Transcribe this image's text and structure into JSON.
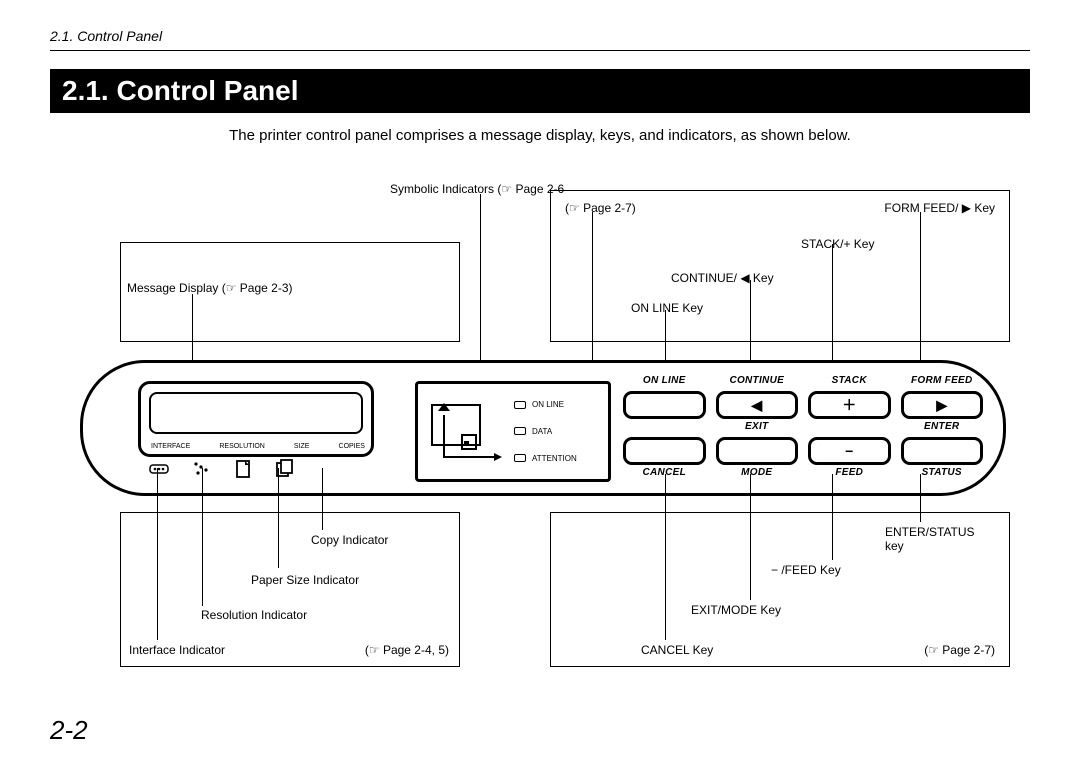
{
  "header": {
    "running": "2.1.  Control Panel",
    "title": "2.1. Control Panel",
    "intro": "The printer control panel comprises a message display, keys, and indicators, as shown below.",
    "page_number": "2-2"
  },
  "callouts": {
    "symbolic_indicators": "Symbolic Indicators (☞ Page 2-6",
    "page27a": "(☞ Page 2-7)",
    "form_feed_key": "FORM FEED/ ▶ Key",
    "stack_plus_key": "STACK/+ Key",
    "continue_key": "CONTINUE/ ◀ Key",
    "online_key": "ON LINE Key",
    "message_display": "Message Display (☞ Page 2-3)",
    "copy_ind": "Copy Indicator",
    "paper_size_ind": "Paper Size Indicator",
    "resolution_ind": "Resolution Indicator",
    "interface_ind": "Interface Indicator",
    "page245": "(☞ Page 2-4, 5)",
    "enter_status_key": "ENTER/STATUS key",
    "minus_feed_key": "− /FEED Key",
    "exit_mode_key": "EXIT/MODE Key",
    "cancel_key": "CANCEL Key",
    "page27b": "(☞ Page 2-7)"
  },
  "lcd_labels": {
    "a": "INTERFACE",
    "b": "RESOLUTION",
    "c": "SIZE",
    "d": "COPIES"
  },
  "leds": {
    "online": "ON LINE",
    "data": "DATA",
    "attention": "ATTENTION"
  },
  "keys": {
    "row1": [
      "ON LINE",
      "CONTINUE",
      "STACK",
      "FORM FEED"
    ],
    "row2_mid": [
      "",
      "EXIT",
      "",
      "ENTER"
    ],
    "row2_glyphs": [
      "",
      "◀",
      "＋",
      "▶"
    ],
    "row3": [
      "CANCEL",
      "MODE",
      "FEED",
      "STATUS"
    ],
    "row3_glyphs": [
      "",
      "",
      "−",
      ""
    ]
  }
}
